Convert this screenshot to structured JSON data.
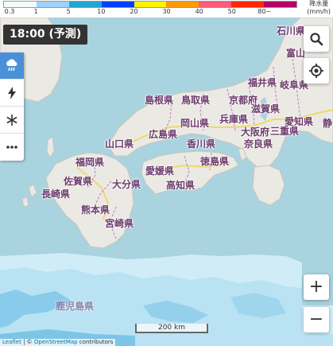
{
  "legend": {
    "unit": "降水量\n(mm/h)",
    "unit_line1": "降水量",
    "unit_line2": "(mm/h)",
    "ticks": [
      "0.3",
      "1",
      "5",
      "10",
      "20",
      "30",
      "40",
      "50",
      "80~"
    ],
    "colors": [
      "#f2fcff",
      "#a0d2ff",
      "#21a6d4",
      "#0041ff",
      "#faf500",
      "#ff9900",
      "#ff5a7a",
      "#ff2800",
      "#b40068"
    ]
  },
  "time_badge": "18:00 (予測)",
  "toolbar": {
    "items": [
      {
        "name": "rain-icon",
        "active": true
      },
      {
        "name": "lightning-icon",
        "active": false
      },
      {
        "name": "snow-icon",
        "active": false
      },
      {
        "name": "more-icon",
        "active": false
      }
    ]
  },
  "controls": {
    "zoom_in": "+",
    "zoom_out": "−",
    "search_icon": "search-icon",
    "locate_icon": "locate-icon"
  },
  "prefectures": {
    "ishikawa": "石川県",
    "toyama": "富山",
    "fukui": "福井県",
    "gifu": "岐阜県",
    "shimane": "島根県",
    "tottori": "鳥取県",
    "kyoto": "京都府",
    "shiga": "滋賀県",
    "aichi": "愛知県",
    "shizuoka": "静",
    "hiroshima": "広島県",
    "okayama": "岡山県",
    "hyogo": "兵庫県",
    "osaka": "大阪府",
    "mie": "三重県",
    "yamaguchi": "山口県",
    "kagawa": "香川県",
    "nara": "奈良県",
    "fukuoka": "福岡県",
    "ehime": "愛媛県",
    "tokushima": "徳島県",
    "saga": "佐賀県",
    "oita": "大分県",
    "kochi": "高知県",
    "nagasaki": "長崎県",
    "kumamoto": "熊本県",
    "miyazaki": "宮崎県",
    "kagoshima": "鹿児島県"
  },
  "scale_label": "200 km",
  "attribution": {
    "leaflet": "Leaflet",
    "sep": " | © ",
    "osm": "OpenStreetMap",
    "contrib": " contributors"
  }
}
